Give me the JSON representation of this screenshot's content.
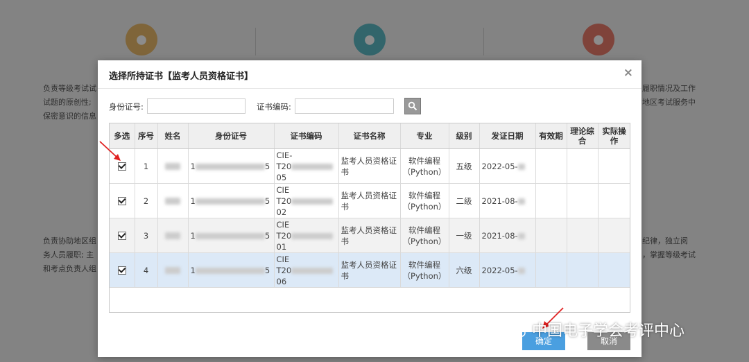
{
  "modal": {
    "title": "选择所持证书【监考人员资格证书】",
    "close": "×",
    "search": {
      "id_label": "身份证号:",
      "cert_label": "证书编码:",
      "id_value": "",
      "cert_value": ""
    },
    "columns": [
      "多选",
      "序号",
      "姓名",
      "身份证号",
      "证书编码",
      "证书名称",
      "专业",
      "级别",
      "发证日期",
      "有效期",
      "理论综合",
      "实际操作"
    ],
    "rows": [
      {
        "checked": true,
        "seq": "1",
        "id_prefix": "1",
        "id_suffix": "5",
        "cert_lines": [
          "CIE-",
          "T20",
          "05"
        ],
        "cert_name": "监考人员资格证书",
        "major": "软件编程（Python）",
        "level": "五级",
        "date": "2022-05-",
        "validity": "",
        "theory": "",
        "practice": ""
      },
      {
        "checked": true,
        "seq": "2",
        "id_prefix": "1",
        "id_suffix": "5",
        "cert_lines": [
          "CIE",
          "T20",
          "02"
        ],
        "cert_name": "监考人员资格证书",
        "major": "软件编程（Python）",
        "level": "二级",
        "date": "2021-08-",
        "validity": "",
        "theory": "",
        "practice": ""
      },
      {
        "checked": true,
        "seq": "3",
        "id_prefix": "1",
        "id_suffix": "5",
        "cert_lines": [
          "CIE",
          "T20",
          "01"
        ],
        "cert_name": "监考人员资格证书",
        "major": "软件编程（Python）",
        "level": "一级",
        "date": "2021-08-",
        "validity": "",
        "theory": "",
        "practice": ""
      },
      {
        "checked": true,
        "seq": "4",
        "id_prefix": "1",
        "id_suffix": "5",
        "cert_lines": [
          "CIE",
          "T20",
          "06"
        ],
        "cert_name": "监考人员资格证书",
        "major": "软件编程（Python）",
        "level": "六级",
        "date": "2022-05-",
        "validity": "",
        "theory": "",
        "practice": ""
      }
    ],
    "ok_label": "确定",
    "cancel_label": "取消"
  },
  "background": {
    "text_left": [
      "负责等级考试试",
      "试题的原创性;",
      "保密意识的信息"
    ],
    "text_right": [
      "履职情况及工作",
      "地区考试服务中"
    ],
    "text_left2": [
      "负责协助地区组",
      "务人员履职; 主",
      "和考点负责人组"
    ],
    "text_right2": [
      "纪律，独立阅",
      "，掌握等级考试"
    ]
  },
  "watermark": "中国电子学会考评中心",
  "colors": {
    "accent": "#4a9fe0",
    "selected_row": "#dce9f7",
    "arrow": "#e02020"
  }
}
